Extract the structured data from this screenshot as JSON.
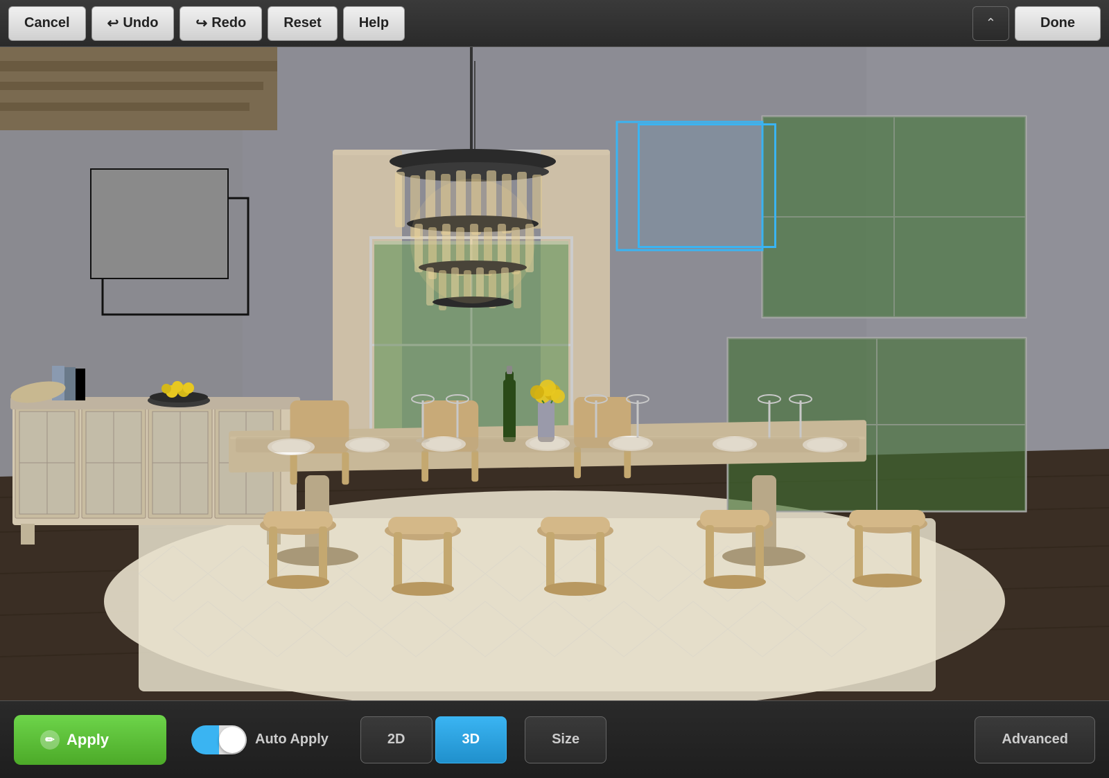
{
  "toolbar": {
    "cancel_label": "Cancel",
    "undo_label": "Undo",
    "redo_label": "Redo",
    "reset_label": "Reset",
    "help_label": "Help",
    "done_label": "Done",
    "chevron_icon": "chevron-up"
  },
  "bottom_bar": {
    "apply_label": "Apply",
    "auto_apply_label": "Auto Apply",
    "view_2d_label": "2D",
    "view_3d_label": "3D",
    "size_label": "Size",
    "advanced_label": "Advanced",
    "toggle_state": "on"
  },
  "scene": {
    "art_frame_left": "picture-frame",
    "selection_rect": "selection-overlay"
  }
}
